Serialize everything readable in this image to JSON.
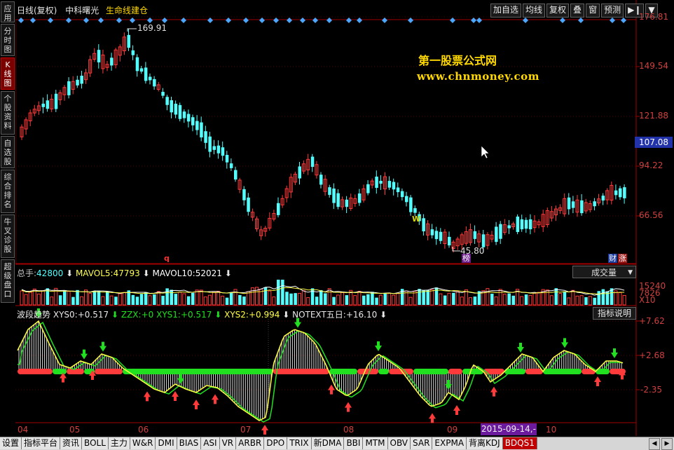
{
  "left_tabs": [
    "应用",
    "分时图",
    "K线图",
    "个股资料",
    "自选股",
    "综合排名",
    "牛叉诊股",
    "超级盘口"
  ],
  "active_left_tab": 2,
  "header": {
    "title": "日线(复权)",
    "stock_name": "中科曙光",
    "formula": "生命线建仓"
  },
  "top_buttons": [
    "加自选",
    "均线",
    "复权",
    "叠",
    "窗",
    "预测"
  ],
  "watermark": {
    "line1": "第一股票公式网",
    "line2": "www.chnmoney.com"
  },
  "price_axis": [
    "176.81",
    "149.54",
    "121.88",
    "94.22",
    "66.56"
  ],
  "price_current": "107.08",
  "annotations": {
    "high": "169.91",
    "low": "45.80",
    "q_mark": "q",
    "w_mark": "W",
    "bang": "榜",
    "cai": "财",
    "zhang": "涨"
  },
  "volume": {
    "label_total": "总手:",
    "total": "42800",
    "label_ma5": "MAVOL5:",
    "ma5": "47793",
    "label_ma10": "MAVOL10:",
    "ma10": "52021",
    "dropdown": "成交量",
    "axis": [
      "15240",
      "7826",
      "X10"
    ]
  },
  "indicator": {
    "name": "波段趋势",
    "xys0_label": "XYS0:",
    "xys0": "+0.517",
    "zzx_label": "ZZX:",
    "zzx": "+0",
    "xys1_label": "XYS1:",
    "xys1": "+0.517",
    "xys2_label": "XYS2:",
    "xys2": "+0.994",
    "notext_label": "NOTEXT五日:",
    "notext": "+16.10",
    "help": "指标说明",
    "axis": [
      "+7.62",
      "+2.68",
      "-2.35"
    ]
  },
  "date_axis": [
    "04",
    "05",
    "06",
    "07",
    "08",
    "09",
    "10"
  ],
  "date_cursor": "2015-09-14,--",
  "bottom_tabs": [
    "设置",
    "指标平台",
    "资讯",
    "BOLL",
    "主力",
    "W&R",
    "DMI",
    "BIAS",
    "ASI",
    "VR",
    "ARBR",
    "DPO",
    "TRIX",
    "新DMA",
    "BBI",
    "MTM",
    "OBV",
    "SAR",
    "EXPMA",
    "背离KDJ",
    "BDQS1"
  ],
  "active_bottom_tab": 20,
  "colors": {
    "up": "#ff3a3a",
    "down": "#54ffff",
    "axis_red": "#a00000",
    "yellow": "#ffff40",
    "green": "#20e020"
  }
}
